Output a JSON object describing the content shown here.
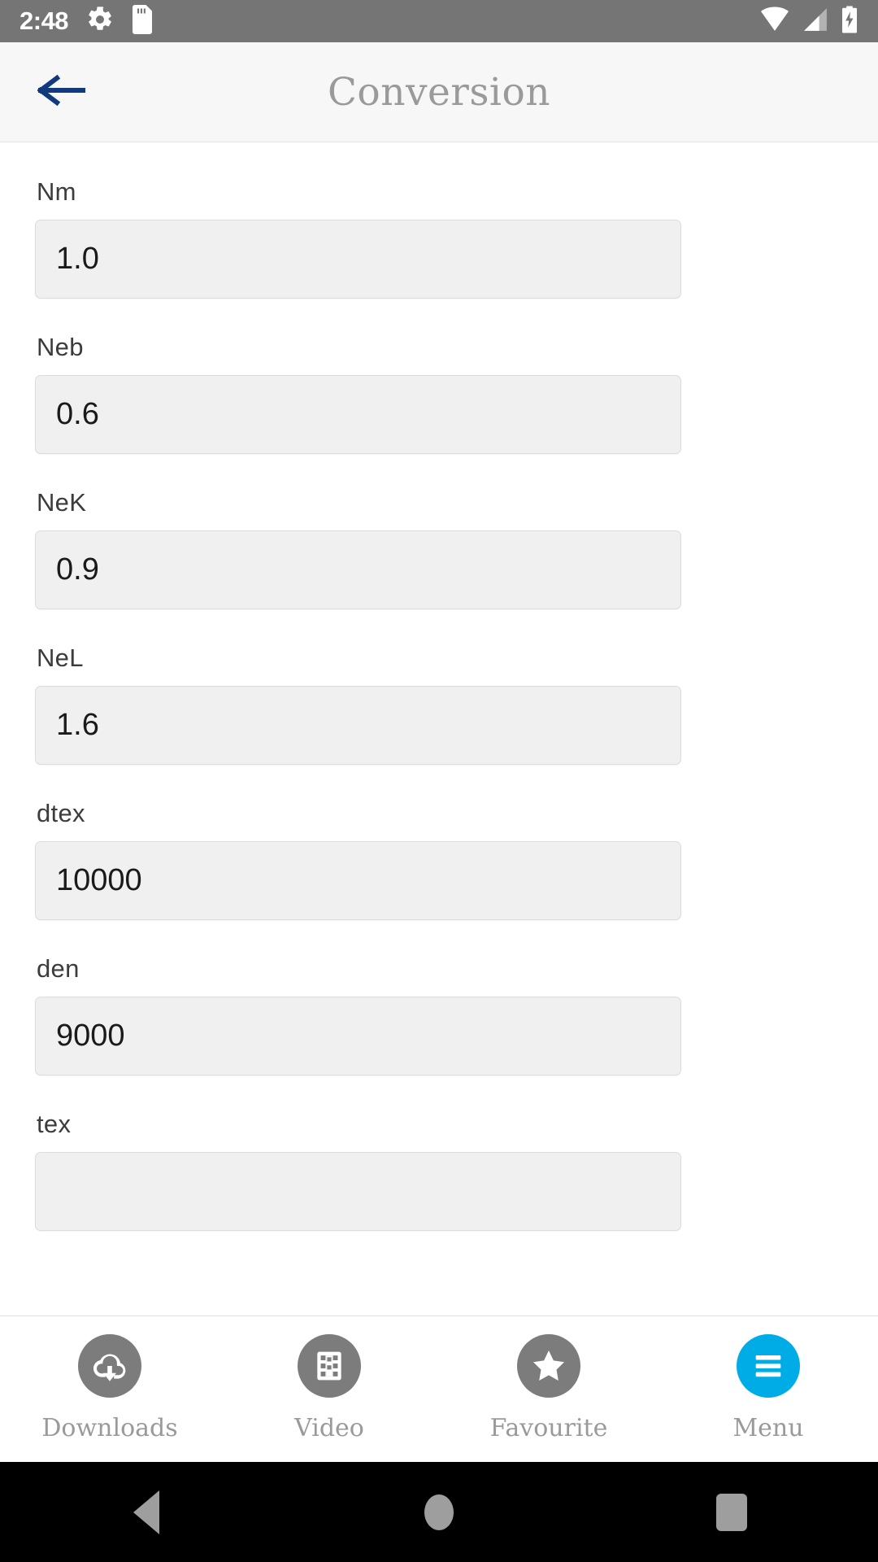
{
  "status_bar": {
    "time": "2:48",
    "left_icons": [
      "gear-icon",
      "sd-card-icon"
    ],
    "right_icons": [
      "wifi-icon",
      "cellular-signal-icon",
      "battery-charging-icon"
    ],
    "background_color": "#757575"
  },
  "app_bar": {
    "title": "Conversion",
    "back_icon": "arrow-left-icon",
    "back_icon_color": "#103a7d",
    "title_color": "#9a9a9a",
    "background_color": "#f7f7f7"
  },
  "form": {
    "fields": [
      {
        "label": "Nm",
        "value": "1.0"
      },
      {
        "label": "Neb",
        "value": "0.6"
      },
      {
        "label": "NeK",
        "value": "0.9"
      },
      {
        "label": "NeL",
        "value": "1.6"
      },
      {
        "label": "dtex",
        "value": "10000"
      },
      {
        "label": "den",
        "value": "9000"
      },
      {
        "label": "tex",
        "value": ""
      }
    ]
  },
  "bottom_nav": {
    "active_color": "#00ace6",
    "inactive_color": "#7c7c7c",
    "items": [
      {
        "label": "Downloads",
        "icon": "cloud-download-icon",
        "active": false
      },
      {
        "label": "Video",
        "icon": "film-strip-icon",
        "active": false
      },
      {
        "label": "Favourite",
        "icon": "star-icon",
        "active": false
      },
      {
        "label": "Menu",
        "icon": "hamburger-menu-icon",
        "active": true
      }
    ]
  },
  "system_nav": {
    "back_label": "Back",
    "home_label": "Home",
    "recents_label": "Recents"
  }
}
